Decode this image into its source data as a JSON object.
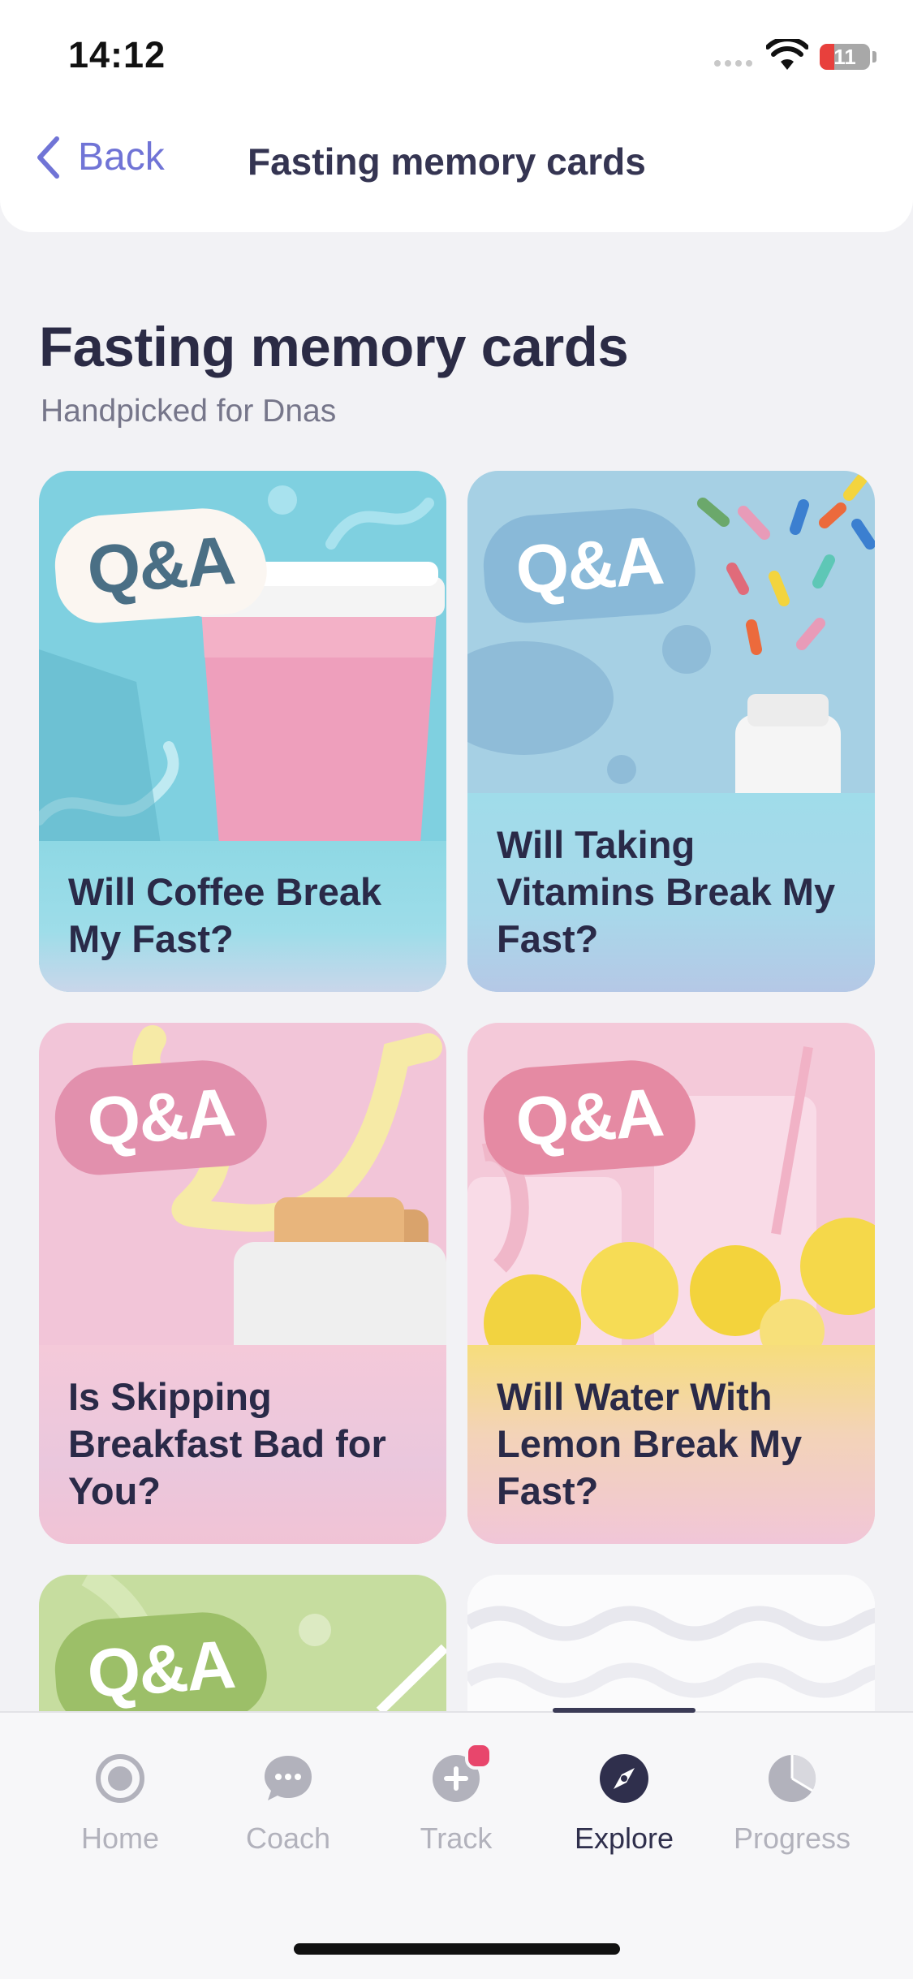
{
  "status_bar": {
    "time": "14:12",
    "battery": "11"
  },
  "nav": {
    "back_label": "Back",
    "title": "Fasting memory cards"
  },
  "header": {
    "title": "Fasting memory cards",
    "subtitle": "Handpicked for Dnas"
  },
  "cards": [
    {
      "badge": "Q&A",
      "title": "Will Coffee Break My Fast?"
    },
    {
      "badge": "Q&A",
      "title": "Will Taking Vitamins Break My Fast?"
    },
    {
      "badge": "Q&A",
      "title": "Is Skipping Breakfast Bad for You?"
    },
    {
      "badge": "Q&A",
      "title": "Will Water With Lemon Break My Fast?"
    },
    {
      "badge": "Q&A",
      "title": ""
    },
    {
      "badge": "",
      "title": ""
    }
  ],
  "tabbar": {
    "items": [
      {
        "label": "Home",
        "icon": "home-icon"
      },
      {
        "label": "Coach",
        "icon": "chat-bubble-icon"
      },
      {
        "label": "Track",
        "icon": "plus-circle-icon"
      },
      {
        "label": "Explore",
        "icon": "compass-icon"
      },
      {
        "label": "Progress",
        "icon": "pie-chart-icon"
      }
    ],
    "active": "Explore"
  },
  "colors": {
    "accent": "#7074d6",
    "card_blue": "#89d6e4",
    "card_sky": "#a9d3e8",
    "card_pink": "#f2c7d8",
    "card_green": "#c7dea0"
  }
}
